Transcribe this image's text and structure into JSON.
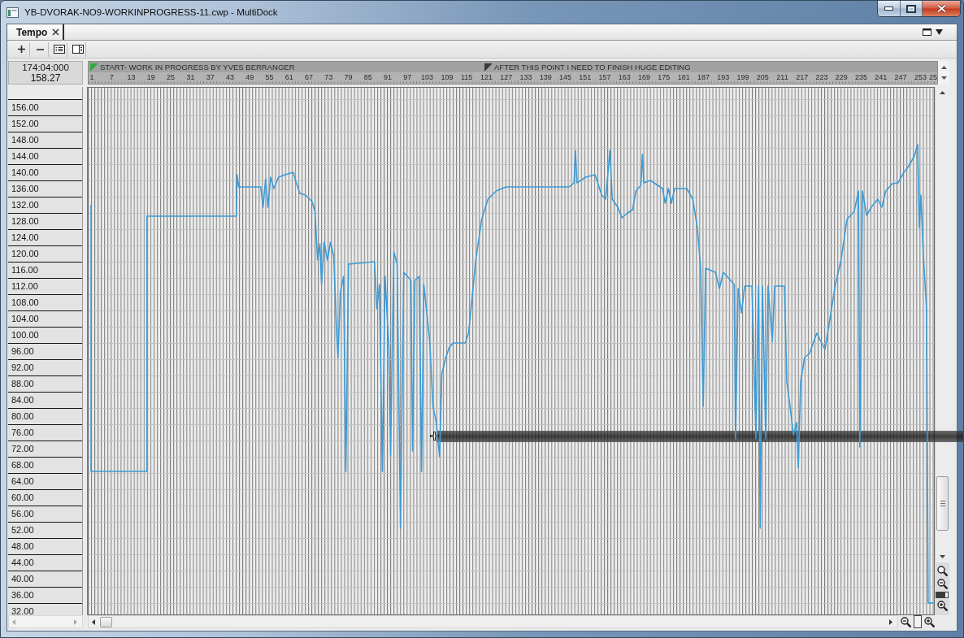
{
  "window": {
    "title": "YB-DVORAK-NO9-WORKINPROGRESS-11.cwp - MultiDock"
  },
  "tabs": [
    {
      "label": "Tempo",
      "selected": true
    }
  ],
  "position": {
    "time": "174:04:000",
    "tempo": "158.27"
  },
  "tempo_view": {
    "ruler": {
      "markers": [
        {
          "label": "START- WORK IN PROGRESS BY YVES BERRANGER",
          "color": "#33a83c"
        },
        {
          "label": "AFTER THIS POINT I NEED TO FINISH HUGE EDITING",
          "color": "#3a3a3a"
        }
      ],
      "partial_label": "25"
    },
    "chart_data": {
      "type": "line",
      "xlim": [
        0,
        257.6
      ],
      "ylim": [
        29,
        159
      ],
      "xticks": [
        {
          "value": 1,
          "label": "1"
        },
        {
          "value": 7,
          "label": "7"
        },
        {
          "value": 13,
          "label": "13"
        },
        {
          "value": 19,
          "label": "19"
        },
        {
          "value": 25,
          "label": "25"
        },
        {
          "value": 31,
          "label": "31"
        },
        {
          "value": 37,
          "label": "37"
        },
        {
          "value": 43,
          "label": "43"
        },
        {
          "value": 49,
          "label": "49"
        },
        {
          "value": 55,
          "label": "55"
        },
        {
          "value": 61,
          "label": "61"
        },
        {
          "value": 67,
          "label": "67"
        },
        {
          "value": 73,
          "label": "73"
        },
        {
          "value": 79,
          "label": "79"
        },
        {
          "value": 85,
          "label": "85"
        },
        {
          "value": 91,
          "label": "91"
        },
        {
          "value": 97,
          "label": "97"
        },
        {
          "value": 103,
          "label": "103"
        },
        {
          "value": 109,
          "label": "109"
        },
        {
          "value": 115,
          "label": "115"
        },
        {
          "value": 121,
          "label": "121"
        },
        {
          "value": 127,
          "label": "127"
        },
        {
          "value": 133,
          "label": "133"
        },
        {
          "value": 139,
          "label": "139"
        },
        {
          "value": 145,
          "label": "145"
        },
        {
          "value": 151,
          "label": "151"
        },
        {
          "value": 157,
          "label": "157"
        },
        {
          "value": 163,
          "label": "163"
        },
        {
          "value": 169,
          "label": "169"
        },
        {
          "value": 175,
          "label": "175"
        },
        {
          "value": 181,
          "label": "181"
        },
        {
          "value": 187,
          "label": "187"
        },
        {
          "value": 193,
          "label": "193"
        },
        {
          "value": 199,
          "label": "199"
        },
        {
          "value": 205,
          "label": "205"
        },
        {
          "value": 211,
          "label": "211"
        },
        {
          "value": 217,
          "label": "217"
        },
        {
          "value": 223,
          "label": "223"
        },
        {
          "value": 229,
          "label": "229"
        },
        {
          "value": 235,
          "label": "235"
        },
        {
          "value": 241,
          "label": "241"
        },
        {
          "value": 247,
          "label": "247"
        },
        {
          "value": 253,
          "label": "253"
        }
      ],
      "yticks": [
        {
          "value": 156,
          "label": "156.00"
        },
        {
          "value": 152,
          "label": "152.00"
        },
        {
          "value": 148,
          "label": "148.00"
        },
        {
          "value": 144,
          "label": "144.00"
        },
        {
          "value": 140,
          "label": "140.00"
        },
        {
          "value": 136,
          "label": "136.00"
        },
        {
          "value": 132,
          "label": "132.00"
        },
        {
          "value": 128,
          "label": "128.00"
        },
        {
          "value": 124,
          "label": "124.00"
        },
        {
          "value": 120,
          "label": "120.00"
        },
        {
          "value": 116,
          "label": "116.00"
        },
        {
          "value": 112,
          "label": "112.00"
        },
        {
          "value": 108,
          "label": "108.00"
        },
        {
          "value": 104,
          "label": "104.00"
        },
        {
          "value": 100,
          "label": "100.00"
        },
        {
          "value": 96,
          "label": "96.00"
        },
        {
          "value": 92,
          "label": "92.00"
        },
        {
          "value": 88,
          "label": "88.00"
        },
        {
          "value": 84,
          "label": "84.00"
        },
        {
          "value": 80,
          "label": "80.00"
        },
        {
          "value": 76,
          "label": "76.00"
        },
        {
          "value": 72,
          "label": "72.00"
        },
        {
          "value": 68,
          "label": "68.00"
        },
        {
          "value": 64,
          "label": "64.00"
        },
        {
          "value": 60,
          "label": "60.00"
        },
        {
          "value": 56,
          "label": "56.00"
        },
        {
          "value": 52,
          "label": "52.00"
        },
        {
          "value": 48,
          "label": "48.00"
        },
        {
          "value": 44,
          "label": "44.00"
        },
        {
          "value": 40,
          "label": "40.00"
        },
        {
          "value": 36,
          "label": "36.00"
        },
        {
          "value": 32,
          "label": "32.00"
        }
      ],
      "x": [
        1,
        1,
        18,
        18,
        45.2,
        45.4,
        45.9,
        52.6,
        53.3,
        54.1,
        54.8,
        55.6,
        56.6,
        58,
        60,
        62.5,
        63.2,
        64.5,
        66.2,
        68.2,
        69.1,
        69.9,
        70.6,
        71.1,
        71.9,
        72.9,
        73.8,
        74.8,
        75.6,
        76.1,
        76.8,
        77.8,
        78.5,
        79.3,
        87.2,
        87.9,
        88.7,
        89.6,
        90.4,
        91.6,
        92.1,
        93.1,
        94.1,
        95.1,
        96.1,
        98.3,
        98.8,
        99.5,
        100.8,
        101.5,
        102.2,
        104,
        105,
        106,
        107,
        107.7,
        108.9,
        109.9,
        111.1,
        114.8,
        115.8,
        116.8,
        118,
        119.8,
        121.7,
        124.2,
        127.2,
        146.4,
        147.9,
        148.3,
        148.8,
        151.4,
        154.3,
        156.3,
        157.5,
        158.8,
        159.5,
        161.2,
        162.5,
        164.2,
        165.7,
        166.7,
        168.2,
        168.7,
        169.1,
        171.1,
        174.8,
        175.6,
        176.6,
        177.5,
        178.5,
        182.2,
        184,
        185.4,
        186.4,
        187.2,
        187.9,
        190.9,
        192.1,
        193.3,
        196.6,
        197,
        197.8,
        198.8,
        199.8,
        202,
        203.2,
        204,
        204.5,
        205.2,
        206.2,
        206.9,
        208.2,
        208.9,
        211.9,
        212.6,
        213.6,
        214.6,
        215.6,
        216.1,
        216.8,
        218,
        219.5,
        221.7,
        224.2,
        225.4,
        227.4,
        229.1,
        230.9,
        233.1,
        234.4,
        234.8,
        235.6,
        236.9,
        238.3,
        240.3,
        241.5,
        242.7,
        244.7,
        246.4,
        248.2,
        249.6,
        251.4,
        252.4,
        252.9,
        253.4,
        254.1,
        254.8,
        255.1,
        255.6,
        257.5
      ],
      "series": [
        {
          "color": "#3d9bd6",
          "values": [
            130,
            64.4,
            64.4,
            127.2,
            127.2,
            137.4,
            134.4,
            134.4,
            129.4,
            136.4,
            129.4,
            136.8,
            134,
            136.8,
            137.4,
            138,
            136,
            132.8,
            132.4,
            130.8,
            128.4,
            116.4,
            120.4,
            110.4,
            120.8,
            116.4,
            120.8,
            117.4,
            100.4,
            92.4,
            108.4,
            112.4,
            64.4,
            115.4,
            116,
            104.4,
            110.4,
            64.4,
            112.4,
            94.4,
            68.4,
            118.4,
            115.4,
            50.4,
            113.4,
            111.4,
            69.4,
            111.4,
            112.4,
            64.4,
            110.4,
            96.4,
            80.4,
            76.4,
            68,
            88.4,
            92.4,
            94.8,
            96,
            96,
            98.4,
            106.4,
            116.4,
            126.4,
            131.4,
            133.4,
            134.4,
            134.4,
            135.4,
            143.4,
            135.4,
            136.8,
            137.4,
            132.4,
            131.4,
            143.4,
            131.4,
            129.4,
            126.8,
            128,
            128.8,
            133.4,
            134.8,
            142.4,
            135.4,
            136,
            134,
            130.4,
            134,
            130.4,
            134,
            134,
            131.4,
            124.4,
            114.4,
            80.4,
            114.4,
            113.4,
            109.4,
            113.4,
            110.4,
            72.4,
            109.4,
            103.4,
            110,
            110,
            72.4,
            110,
            50.4,
            110,
            72.4,
            110,
            96.4,
            110,
            110,
            86.4,
            80.4,
            73.4,
            76.4,
            65.4,
            86.4,
            92.4,
            93.4,
            98.4,
            94.4,
            100.4,
            110.4,
            116.4,
            126.4,
            128.4,
            133.4,
            70.4,
            133.4,
            127.4,
            129.4,
            131.4,
            129.4,
            133.4,
            135.2,
            135.4,
            138,
            139.4,
            142,
            144.8,
            124.4,
            132.4,
            118.4,
            108.4,
            104.4,
            32,
            32
          ]
        }
      ]
    }
  },
  "vertical_zoom": {
    "level": 0.75
  },
  "horizontal_zoom": {
    "level": 0
  }
}
